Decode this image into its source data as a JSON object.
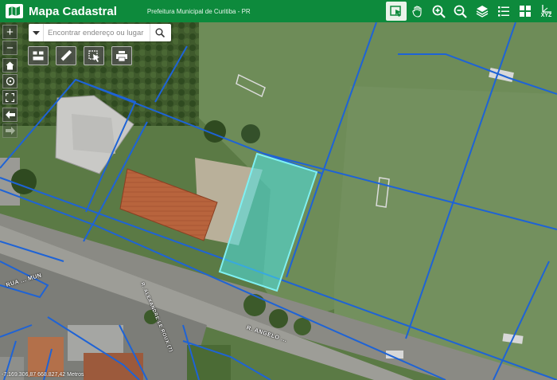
{
  "header": {
    "app_title": "Mapa Cadastral",
    "subtitle": "Prefeitura Municipal de Curitiba - PR"
  },
  "toolbar": {
    "tools": [
      {
        "name": "identify-tool",
        "icon": "identify-icon",
        "active": true
      },
      {
        "name": "pan-tool",
        "icon": "hand-icon",
        "active": false
      },
      {
        "name": "zoom-in-tool",
        "icon": "zoom-in-icon",
        "active": false
      },
      {
        "name": "zoom-out-tool",
        "icon": "zoom-out-icon",
        "active": false
      },
      {
        "name": "layers-tool",
        "icon": "layers-icon",
        "active": false
      },
      {
        "name": "legend-tool",
        "icon": "list-icon",
        "active": false
      },
      {
        "name": "basemap-tool",
        "icon": "grid-icon",
        "active": false
      },
      {
        "name": "coordinates-tool",
        "icon": "xyz-icon",
        "active": false
      }
    ],
    "xyz_label": "XYZ"
  },
  "left_controls": {
    "zoom_in_label": "+",
    "zoom_out_label": "−"
  },
  "search": {
    "placeholder": "Encontrar endereço ou lugar"
  },
  "map": {
    "coordinates_text": "-7.169.306,87 668.827,42 Metros",
    "street_labels": [
      "RUA DR. ANTONIO ...",
      "R. ALEXANDRE LE ROUX (?)",
      "R. ANGELO ...",
      "RUA ... MUN"
    ]
  },
  "colors": {
    "header_green": "#0d8a3c",
    "parcel_line": "#1e63d6",
    "selected_parcel_fill": "#4fe3e6",
    "selected_parcel_stroke": "#7ff0f2"
  }
}
